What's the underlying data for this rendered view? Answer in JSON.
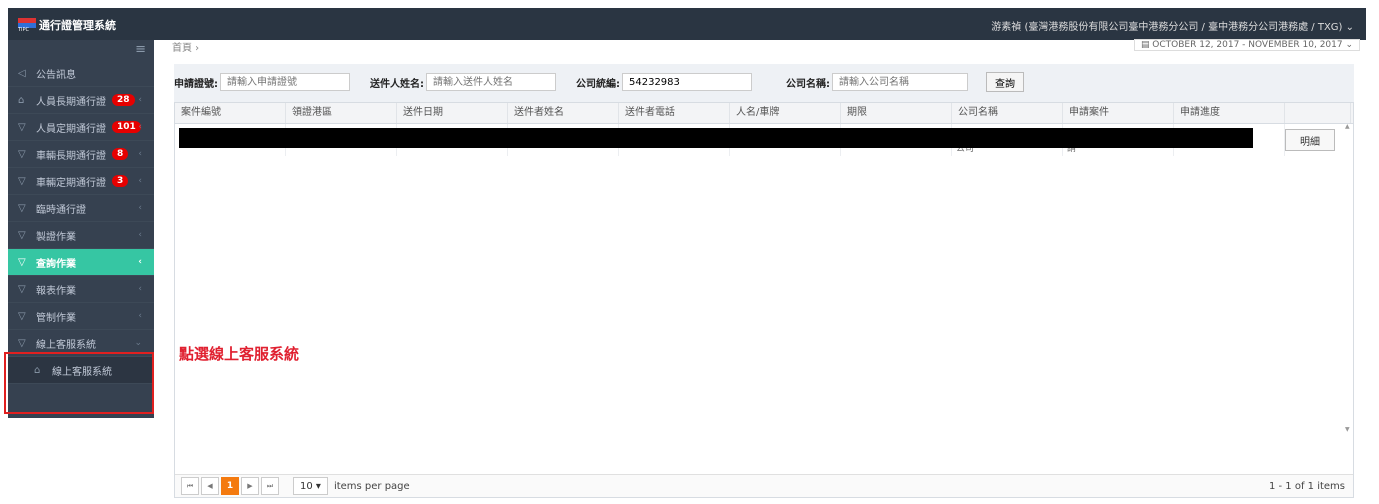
{
  "app": {
    "title": "通行證管理系統",
    "logo_sub": "TIPC"
  },
  "user": {
    "info": "游素禎 (臺灣港務股份有限公司臺中港務分公司 / 臺中港務分公司港務處 / TXG) ⌄"
  },
  "breadcrumb": {
    "home": "首頁 ›"
  },
  "daterange": "▤ OCTOBER 12, 2017 - NOVEMBER 10, 2017 ⌄",
  "sidebar": {
    "toggle": "≡",
    "items": [
      {
        "label": "公告訊息",
        "icon": "◁",
        "chev": "",
        "badge": ""
      },
      {
        "label": "人員長期通行證",
        "icon": "⌂",
        "chev": "‹",
        "badge": "28"
      },
      {
        "label": "人員定期通行證",
        "icon": "▽",
        "chev": "‹",
        "badge": "101"
      },
      {
        "label": "車輛長期通行證",
        "icon": "▽",
        "chev": "‹",
        "badge": "8"
      },
      {
        "label": "車輛定期通行證",
        "icon": "▽",
        "chev": "‹",
        "badge": "3"
      },
      {
        "label": "臨時通行證",
        "icon": "▽",
        "chev": "‹",
        "badge": ""
      },
      {
        "label": "製證作業",
        "icon": "▽",
        "chev": "‹",
        "badge": ""
      },
      {
        "label": "查詢作業",
        "icon": "▽",
        "chev": "‹",
        "badge": ""
      },
      {
        "label": "報表作業",
        "icon": "▽",
        "chev": "‹",
        "badge": ""
      },
      {
        "label": "管制作業",
        "icon": "▽",
        "chev": "‹",
        "badge": ""
      },
      {
        "label": "線上客服系統",
        "icon": "▽",
        "chev": "⌄",
        "badge": ""
      },
      {
        "label": "線上客服系統",
        "icon": "⌂",
        "chev": "",
        "badge": ""
      }
    ]
  },
  "filters": {
    "app_no_label": "申請證號:",
    "app_no_placeholder": "請輸入申請證號",
    "sender_label": "送件人姓名:",
    "sender_placeholder": "請輸入送件人姓名",
    "taxid_label": "公司統編:",
    "taxid_value": "54232983",
    "company_label": "公司名稱:",
    "company_placeholder": "請輸入公司名稱",
    "query_button": "查詢"
  },
  "table": {
    "headers": [
      "案件編號",
      "領證港區",
      "送件日期",
      "送件者姓名",
      "送件者電話",
      "人名/車牌",
      "期限",
      "公司名稱",
      "申請案件",
      "申請進度",
      ""
    ],
    "row": {
      "company_tail": "公司",
      "case_tail": "請",
      "detail_button": "明細"
    }
  },
  "annotation": "點選線上客服系統",
  "pager": {
    "first": "⏮",
    "prev": "◀",
    "page": "1",
    "next": "▶",
    "last": "⏭",
    "per_page": "10  ▾",
    "items_per_page": "items per page",
    "count": "1 - 1 of 1 items"
  }
}
